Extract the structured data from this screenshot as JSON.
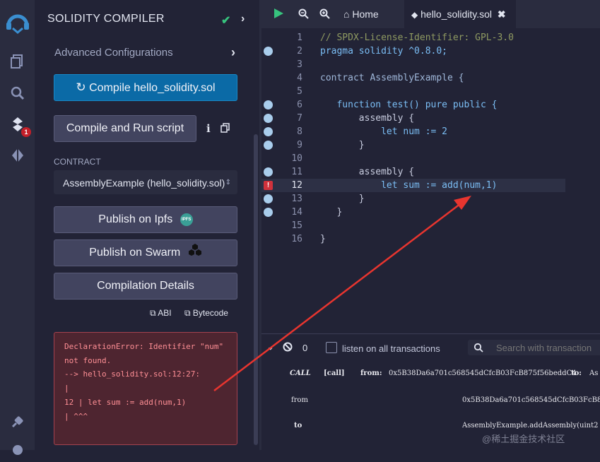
{
  "colors": {
    "accent": "#0b6aa6",
    "success": "#37c37e",
    "error": "#d1323c"
  },
  "iconbar": {
    "badge": "1",
    "icons": [
      "remix-logo-icon",
      "file-explorer-icon",
      "search-icon",
      "solidity-compiler-icon",
      "deploy-icon",
      "plugin-manager-icon",
      "settings-icon"
    ]
  },
  "panel": {
    "title": "SOLIDITY COMPILER",
    "advanced": "Advanced Configurations",
    "compile_button": "Compile hello_solidity.sol",
    "compile_run_button": "Compile and Run script",
    "contract_label": "CONTRACT",
    "contract_selected": "AssemblyExample (hello_solidity.sol)",
    "publish_ipfs": "Publish on Ipfs",
    "ipfs_badge": "IPFS",
    "publish_swarm": "Publish on Swarm",
    "compilation_details": "Compilation Details",
    "abi": "ABI",
    "bytecode": "Bytecode",
    "error_lines": [
      "DeclarationError: Identifier \"num\"",
      "not found.",
      "--> hello_solidity.sol:12:27:",
      "|",
      "12 | let sum := add(num,1)",
      "| ^^^"
    ]
  },
  "tabs": {
    "home": "Home",
    "file": "hello_solidity.sol"
  },
  "code_lines": [
    {
      "n": "1",
      "text": "// SPDX-License-Identifier: GPL-3.0"
    },
    {
      "n": "2",
      "text": "pragma solidity ^0.8.0;"
    },
    {
      "n": "3",
      "text": ""
    },
    {
      "n": "4",
      "text": "contract AssemblyExample {"
    },
    {
      "n": "5",
      "text": ""
    },
    {
      "n": "6",
      "text": "   function test() pure public {"
    },
    {
      "n": "7",
      "text": "       assembly {"
    },
    {
      "n": "8",
      "text": "           let num := 2"
    },
    {
      "n": "9",
      "text": "       }"
    },
    {
      "n": "10",
      "text": ""
    },
    {
      "n": "11",
      "text": "       assembly {"
    },
    {
      "n": "12",
      "text": "           let sum := add(num,1)"
    },
    {
      "n": "13",
      "text": "       }"
    },
    {
      "n": "14",
      "text": "   }"
    },
    {
      "n": "15",
      "text": ""
    },
    {
      "n": "16",
      "text": "}"
    }
  ],
  "terminal": {
    "count": "0",
    "listen_label": "listen on all transactions",
    "search_placeholder": "Search with transaction",
    "call_tag": "CALL",
    "call_kind": "[call]",
    "from_label": "from:",
    "from_short": "0x5B38Da6a701c568545dCfcB03FcB875f56beddC4",
    "to_label": "to:",
    "to_short": "As",
    "row_from_key": "from",
    "row_from_val": "0x5B38Da6a701c568545dCfcB03FcB875f56",
    "row_to_key": "to",
    "row_to_val": "AssemblyExample.addAssembly(uint2",
    "watermark": "@稀土掘金技术社区"
  }
}
